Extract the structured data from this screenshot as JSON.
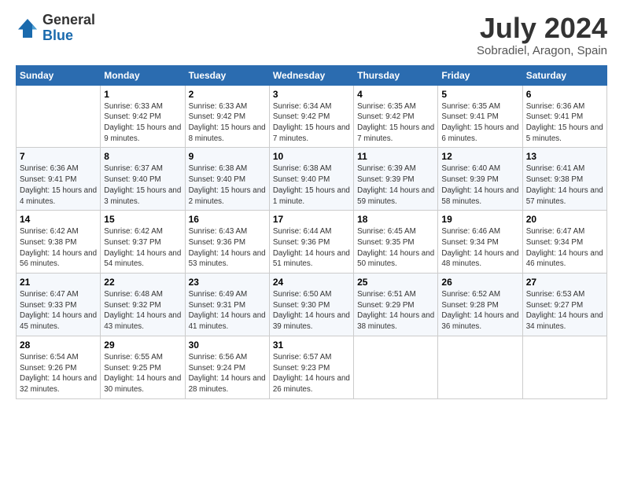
{
  "header": {
    "logo_general": "General",
    "logo_blue": "Blue",
    "month": "July 2024",
    "location": "Sobradiel, Aragon, Spain"
  },
  "days_of_week": [
    "Sunday",
    "Monday",
    "Tuesday",
    "Wednesday",
    "Thursday",
    "Friday",
    "Saturday"
  ],
  "weeks": [
    [
      {
        "day": "",
        "sunrise": "",
        "sunset": "",
        "daylight": ""
      },
      {
        "day": "1",
        "sunrise": "Sunrise: 6:33 AM",
        "sunset": "Sunset: 9:42 PM",
        "daylight": "Daylight: 15 hours and 9 minutes."
      },
      {
        "day": "2",
        "sunrise": "Sunrise: 6:33 AM",
        "sunset": "Sunset: 9:42 PM",
        "daylight": "Daylight: 15 hours and 8 minutes."
      },
      {
        "day": "3",
        "sunrise": "Sunrise: 6:34 AM",
        "sunset": "Sunset: 9:42 PM",
        "daylight": "Daylight: 15 hours and 7 minutes."
      },
      {
        "day": "4",
        "sunrise": "Sunrise: 6:35 AM",
        "sunset": "Sunset: 9:42 PM",
        "daylight": "Daylight: 15 hours and 7 minutes."
      },
      {
        "day": "5",
        "sunrise": "Sunrise: 6:35 AM",
        "sunset": "Sunset: 9:41 PM",
        "daylight": "Daylight: 15 hours and 6 minutes."
      },
      {
        "day": "6",
        "sunrise": "Sunrise: 6:36 AM",
        "sunset": "Sunset: 9:41 PM",
        "daylight": "Daylight: 15 hours and 5 minutes."
      }
    ],
    [
      {
        "day": "7",
        "sunrise": "Sunrise: 6:36 AM",
        "sunset": "Sunset: 9:41 PM",
        "daylight": "Daylight: 15 hours and 4 minutes."
      },
      {
        "day": "8",
        "sunrise": "Sunrise: 6:37 AM",
        "sunset": "Sunset: 9:40 PM",
        "daylight": "Daylight: 15 hours and 3 minutes."
      },
      {
        "day": "9",
        "sunrise": "Sunrise: 6:38 AM",
        "sunset": "Sunset: 9:40 PM",
        "daylight": "Daylight: 15 hours and 2 minutes."
      },
      {
        "day": "10",
        "sunrise": "Sunrise: 6:38 AM",
        "sunset": "Sunset: 9:40 PM",
        "daylight": "Daylight: 15 hours and 1 minute."
      },
      {
        "day": "11",
        "sunrise": "Sunrise: 6:39 AM",
        "sunset": "Sunset: 9:39 PM",
        "daylight": "Daylight: 14 hours and 59 minutes."
      },
      {
        "day": "12",
        "sunrise": "Sunrise: 6:40 AM",
        "sunset": "Sunset: 9:39 PM",
        "daylight": "Daylight: 14 hours and 58 minutes."
      },
      {
        "day": "13",
        "sunrise": "Sunrise: 6:41 AM",
        "sunset": "Sunset: 9:38 PM",
        "daylight": "Daylight: 14 hours and 57 minutes."
      }
    ],
    [
      {
        "day": "14",
        "sunrise": "Sunrise: 6:42 AM",
        "sunset": "Sunset: 9:38 PM",
        "daylight": "Daylight: 14 hours and 56 minutes."
      },
      {
        "day": "15",
        "sunrise": "Sunrise: 6:42 AM",
        "sunset": "Sunset: 9:37 PM",
        "daylight": "Daylight: 14 hours and 54 minutes."
      },
      {
        "day": "16",
        "sunrise": "Sunrise: 6:43 AM",
        "sunset": "Sunset: 9:36 PM",
        "daylight": "Daylight: 14 hours and 53 minutes."
      },
      {
        "day": "17",
        "sunrise": "Sunrise: 6:44 AM",
        "sunset": "Sunset: 9:36 PM",
        "daylight": "Daylight: 14 hours and 51 minutes."
      },
      {
        "day": "18",
        "sunrise": "Sunrise: 6:45 AM",
        "sunset": "Sunset: 9:35 PM",
        "daylight": "Daylight: 14 hours and 50 minutes."
      },
      {
        "day": "19",
        "sunrise": "Sunrise: 6:46 AM",
        "sunset": "Sunset: 9:34 PM",
        "daylight": "Daylight: 14 hours and 48 minutes."
      },
      {
        "day": "20",
        "sunrise": "Sunrise: 6:47 AM",
        "sunset": "Sunset: 9:34 PM",
        "daylight": "Daylight: 14 hours and 46 minutes."
      }
    ],
    [
      {
        "day": "21",
        "sunrise": "Sunrise: 6:47 AM",
        "sunset": "Sunset: 9:33 PM",
        "daylight": "Daylight: 14 hours and 45 minutes."
      },
      {
        "day": "22",
        "sunrise": "Sunrise: 6:48 AM",
        "sunset": "Sunset: 9:32 PM",
        "daylight": "Daylight: 14 hours and 43 minutes."
      },
      {
        "day": "23",
        "sunrise": "Sunrise: 6:49 AM",
        "sunset": "Sunset: 9:31 PM",
        "daylight": "Daylight: 14 hours and 41 minutes."
      },
      {
        "day": "24",
        "sunrise": "Sunrise: 6:50 AM",
        "sunset": "Sunset: 9:30 PM",
        "daylight": "Daylight: 14 hours and 39 minutes."
      },
      {
        "day": "25",
        "sunrise": "Sunrise: 6:51 AM",
        "sunset": "Sunset: 9:29 PM",
        "daylight": "Daylight: 14 hours and 38 minutes."
      },
      {
        "day": "26",
        "sunrise": "Sunrise: 6:52 AM",
        "sunset": "Sunset: 9:28 PM",
        "daylight": "Daylight: 14 hours and 36 minutes."
      },
      {
        "day": "27",
        "sunrise": "Sunrise: 6:53 AM",
        "sunset": "Sunset: 9:27 PM",
        "daylight": "Daylight: 14 hours and 34 minutes."
      }
    ],
    [
      {
        "day": "28",
        "sunrise": "Sunrise: 6:54 AM",
        "sunset": "Sunset: 9:26 PM",
        "daylight": "Daylight: 14 hours and 32 minutes."
      },
      {
        "day": "29",
        "sunrise": "Sunrise: 6:55 AM",
        "sunset": "Sunset: 9:25 PM",
        "daylight": "Daylight: 14 hours and 30 minutes."
      },
      {
        "day": "30",
        "sunrise": "Sunrise: 6:56 AM",
        "sunset": "Sunset: 9:24 PM",
        "daylight": "Daylight: 14 hours and 28 minutes."
      },
      {
        "day": "31",
        "sunrise": "Sunrise: 6:57 AM",
        "sunset": "Sunset: 9:23 PM",
        "daylight": "Daylight: 14 hours and 26 minutes."
      },
      {
        "day": "",
        "sunrise": "",
        "sunset": "",
        "daylight": ""
      },
      {
        "day": "",
        "sunrise": "",
        "sunset": "",
        "daylight": ""
      },
      {
        "day": "",
        "sunrise": "",
        "sunset": "",
        "daylight": ""
      }
    ]
  ]
}
